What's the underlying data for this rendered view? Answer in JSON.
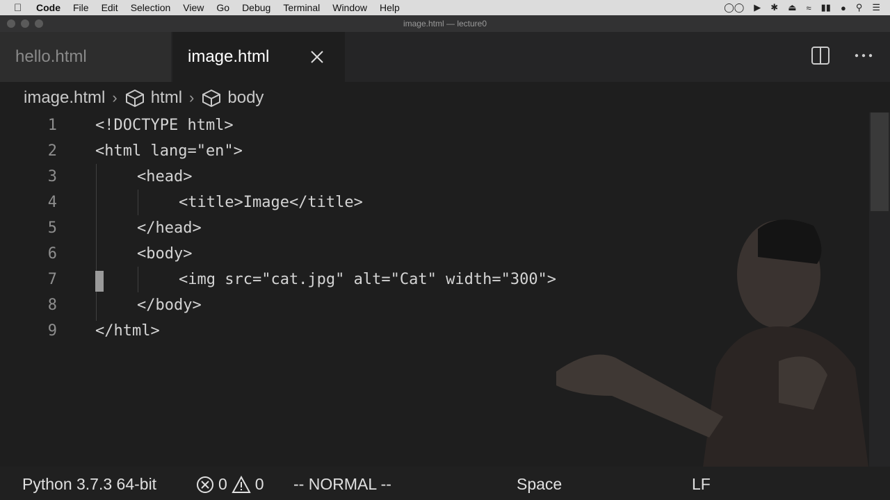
{
  "menubar": {
    "app": "Code",
    "items": [
      "File",
      "Edit",
      "Selection",
      "View",
      "Go",
      "Debug",
      "Terminal",
      "Window",
      "Help"
    ]
  },
  "window": {
    "title": "image.html — lecture0"
  },
  "tabs": [
    {
      "label": "hello.html",
      "active": false
    },
    {
      "label": "image.html",
      "active": true
    }
  ],
  "breadcrumb": [
    "image.html",
    "html",
    "body"
  ],
  "editor": {
    "lines": [
      {
        "n": "1",
        "text": "<!DOCTYPE html>"
      },
      {
        "n": "2",
        "text": "<html lang=\"en\">"
      },
      {
        "n": "3",
        "text": "<head>"
      },
      {
        "n": "4",
        "text": "<title>Image</title>"
      },
      {
        "n": "5",
        "text": "</head>"
      },
      {
        "n": "6",
        "text": "<body>"
      },
      {
        "n": "7",
        "text": "<img src=\"cat.jpg\" alt=\"Cat\" width=\"300\">"
      },
      {
        "n": "8",
        "text": "</body>"
      },
      {
        "n": "9",
        "text": "</html>"
      }
    ]
  },
  "statusbar": {
    "python": "Python 3.7.3 64-bit",
    "errors": "0",
    "warnings": "0",
    "mode": "-- NORMAL --",
    "spaces": "Space",
    "eol": "LF"
  },
  "colors": {
    "editor_bg": "#1e1e1e",
    "tab_inactive": "#2d2d2d",
    "statusbar": "#202020"
  }
}
